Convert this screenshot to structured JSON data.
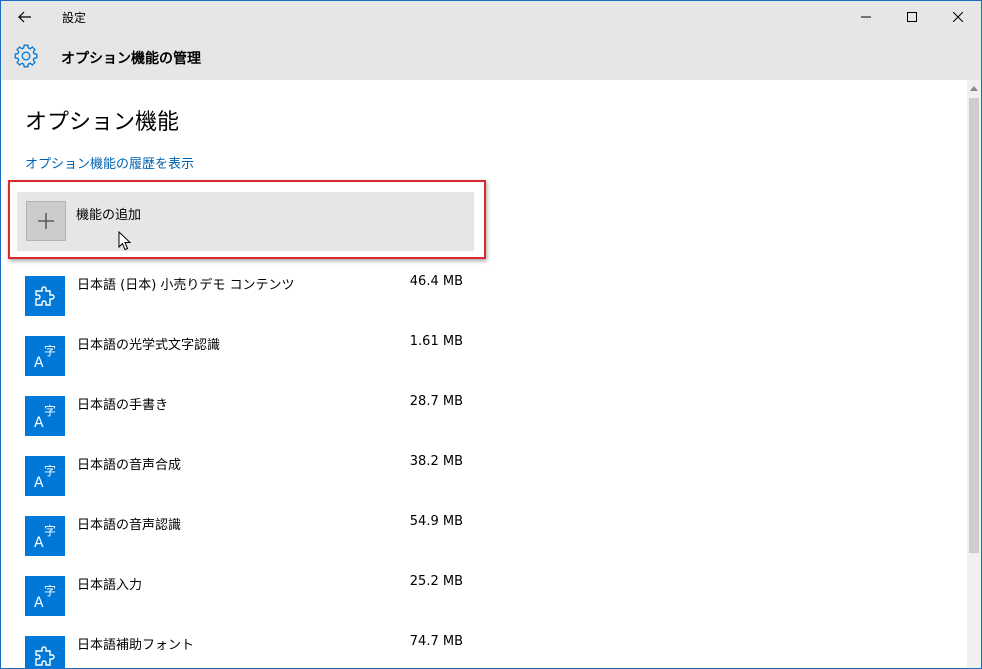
{
  "window": {
    "title": "設定",
    "controls": {
      "minimize": "minimize-icon",
      "maximize": "maximize-icon",
      "close": "close-icon"
    }
  },
  "header": {
    "title": "オプション機能の管理",
    "icon": "gear-icon"
  },
  "main": {
    "title": "オプション機能",
    "history_link": "オプション機能の履歴を表示",
    "add_feature": {
      "label": "機能の追加",
      "icon": "plus-icon"
    },
    "features": [
      {
        "name": "日本語 (日本) 小売りデモ コンテンツ",
        "size": "46.4 MB",
        "icon": "puzzle-icon"
      },
      {
        "name": "日本語の光学式文字認識",
        "size": "1.61 MB",
        "icon": "language-icon"
      },
      {
        "name": "日本語の手書き",
        "size": "28.7 MB",
        "icon": "language-icon"
      },
      {
        "name": "日本語の音声合成",
        "size": "38.2 MB",
        "icon": "language-icon"
      },
      {
        "name": "日本語の音声認識",
        "size": "54.9 MB",
        "icon": "language-icon"
      },
      {
        "name": "日本語入力",
        "size": "25.2 MB",
        "icon": "language-icon"
      },
      {
        "name": "日本語補助フォント",
        "size": "74.7 MB",
        "icon": "puzzle-icon"
      }
    ]
  },
  "colors": {
    "accent": "#0078d7",
    "link": "#0063b1",
    "highlight_border": "#d9282f",
    "chrome_bg": "#e6e6e6"
  }
}
